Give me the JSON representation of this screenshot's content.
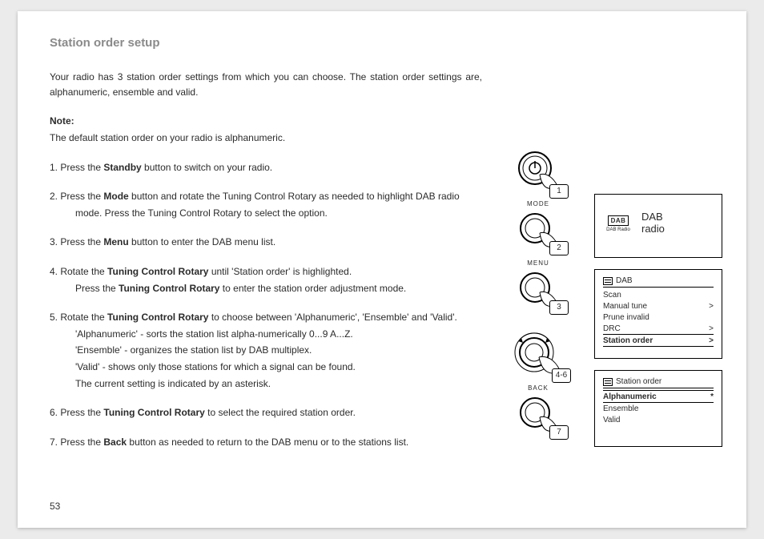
{
  "title": "Station order setup",
  "intro": "Your radio has 3 station order settings from which you can choose. The station order settings are, alphanumeric, ensemble and valid.",
  "note_label": "Note:",
  "note_body": "The default station order on your radio is alphanumeric.",
  "steps": {
    "s1a": "1. Press the ",
    "s1b": " button to switch on your radio.",
    "s1_bold": "Standby",
    "s2a": "2. Press the ",
    "s2b": " button and rotate the Tuning Control Rotary as needed to highlight DAB radio",
    "s2_bold": "Mode",
    "s2c": "mode. Press the Tuning Control Rotary to select the option.",
    "s3a": "3. Press the ",
    "s3b": " button to enter the DAB menu list.",
    "s3_bold": "Menu",
    "s4a": "4. Rotate the ",
    "s4b": " until 'Station order' is highlighted.",
    "s4_bold": "Tuning Control Rotary",
    "s4c_a": "Press the ",
    "s4c_b": " to enter the station order adjustment mode.",
    "s4c_bold": "Tuning Control Rotary",
    "s5a": "5. Rotate the ",
    "s5b": " to choose between 'Alphanumeric', 'Ensemble' and 'Valid'.",
    "s5_bold": "Tuning Control Rotary",
    "s5c": "'Alphanumeric' - sorts the station list alpha-numerically 0...9 A...Z.",
    "s5d": "'Ensemble' - organizes the station list by DAB multiplex.",
    "s5e": "'Valid' - shows only those stations for which a signal can be found.",
    "s5f": "The current setting is indicated by an asterisk.",
    "s6a": "6. Press the ",
    "s6b": " to select the required station order.",
    "s6_bold": "Tuning Control Rotary",
    "s7a": "7. Press the ",
    "s7b": " button as needed to return to the DAB menu or to the stations list.",
    "s7_bold": "Back"
  },
  "page_number": "53",
  "buttons": {
    "b1": "1",
    "b2": "2",
    "b3": "3",
    "b4": "4-6",
    "b5": "7",
    "mode": "MODE",
    "menu": "MENU",
    "back": "BACK"
  },
  "screens": {
    "dab_logo": "DAB",
    "dab_logo_sub": "DAB Radio",
    "dab_title": "DAB\nradio",
    "menu1_title": "DAB",
    "menu1": {
      "r0": "Scan",
      "r1": "Manual tune",
      "r2": "Prune invalid",
      "r3": "DRC",
      "r4": "Station order"
    },
    "menu2_title": "Station order",
    "menu2": {
      "r0": "Alphanumeric",
      "r1": "Ensemble",
      "r2": "Valid"
    },
    "star": "*",
    "chev": ">"
  }
}
